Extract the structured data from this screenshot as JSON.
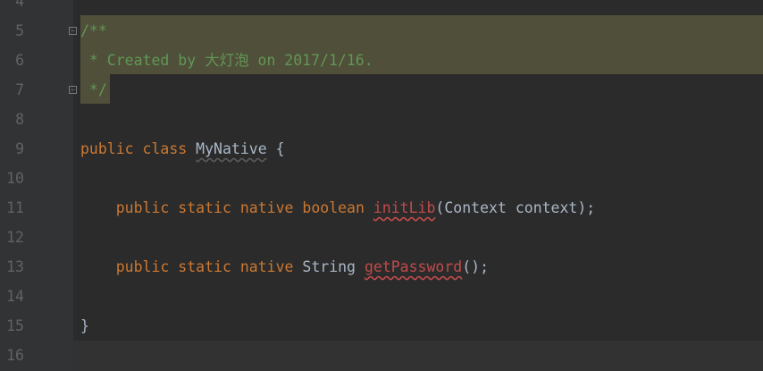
{
  "editor": {
    "lines": [
      {
        "num": "4"
      },
      {
        "num": "5",
        "comment": "/**"
      },
      {
        "num": "6",
        "comment": " * Created by 大灯泡 on 2017/1/16."
      },
      {
        "num": "7",
        "comment": " */"
      },
      {
        "num": "8"
      },
      {
        "num": "9",
        "kw1": "public",
        "kw2": "class",
        "cls": "MyNative",
        "rest": " {"
      },
      {
        "num": "10"
      },
      {
        "num": "11",
        "indent": "    ",
        "kw1": "public",
        "kw2": "static",
        "kw3": "native",
        "kw4": "boolean",
        "method": "initLib",
        "rest": "(Context context);"
      },
      {
        "num": "12"
      },
      {
        "num": "13",
        "indent": "    ",
        "kw1": "public",
        "kw2": "static",
        "kw3": "native",
        "type": "String",
        "method": "getPassword",
        "rest": "();"
      },
      {
        "num": "14"
      },
      {
        "num": "15",
        "rest": "}"
      },
      {
        "num": "16"
      }
    ]
  },
  "colors": {
    "background": "#2b2b2b",
    "keyword": "#cc7832",
    "comment": "#629755",
    "unused_method": "#c14b4b",
    "plain": "#a9b7c6",
    "comment_highlight": "#4f4f3a"
  }
}
